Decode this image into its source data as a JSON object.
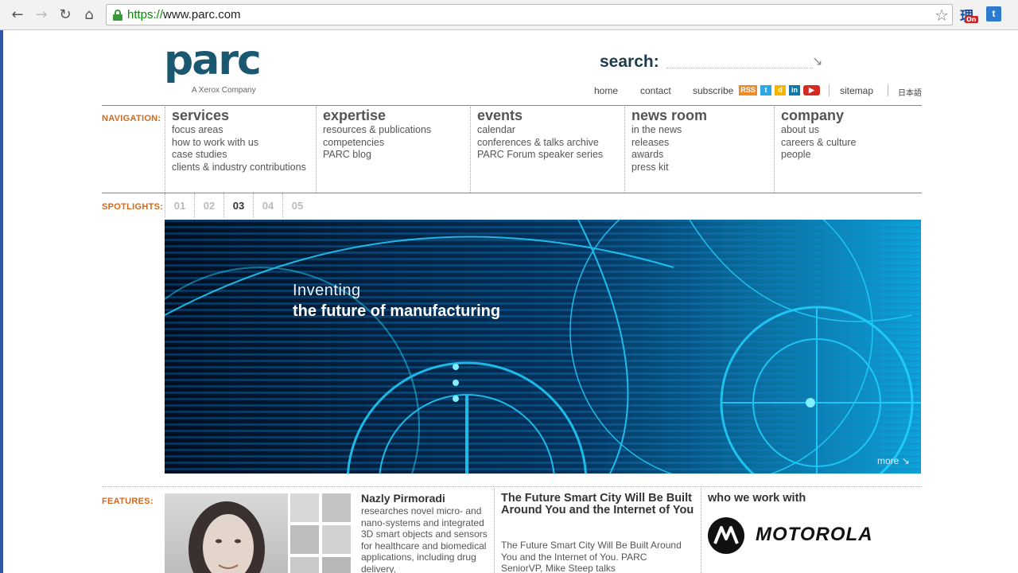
{
  "browser": {
    "url_scheme": "https://",
    "url_host": "www.parc.com",
    "ext1_glyph": "理",
    "ext1_badge": "On",
    "ext2_glyph": "t"
  },
  "header": {
    "logo_text": "parc",
    "logo_tagline": "A Xerox Company",
    "search_label": "search:",
    "search_value": "",
    "top_links": {
      "home": "home",
      "contact": "contact",
      "subscribe": "subscribe",
      "rss": "RSS",
      "sitemap": "sitemap",
      "japanese": "日本語"
    }
  },
  "navigation": {
    "label": "NAVIGATION:",
    "columns": [
      {
        "title": "services",
        "items": [
          "focus areas",
          "how to work with us",
          "case studies",
          "clients & industry contributions"
        ]
      },
      {
        "title": "expertise",
        "items": [
          "resources & publications",
          "competencies",
          "PARC blog"
        ]
      },
      {
        "title": "events",
        "items": [
          "calendar",
          "conferences & talks archive",
          "PARC Forum speaker series"
        ]
      },
      {
        "title": "news room",
        "items": [
          "in the news",
          "releases",
          "awards",
          "press kit"
        ]
      },
      {
        "title": "company",
        "items": [
          "about us",
          "careers & culture",
          "people"
        ]
      }
    ]
  },
  "spotlights": {
    "label": "SPOTLIGHTS:",
    "tabs": [
      "01",
      "02",
      "03",
      "04",
      "05"
    ],
    "active": "03",
    "hero_line1": "Inventing",
    "hero_line2": "the future of manufacturing",
    "more_label": "more"
  },
  "features": {
    "label": "FEATURES:",
    "person_name": "Nazly Pirmoradi",
    "person_body": "researches novel micro- and nano-systems and integrated 3D smart objects and sensors for healthcare and biomedical applications, including drug delivery,",
    "news_title": "The Future Smart City Will Be Built Around You and the Internet of You",
    "news_body": "The Future Smart City Will Be Built Around You and the Internet of You. PARC SeniorVP, Mike Steep talks",
    "partners_title": "who we work with",
    "partner_name": "MOTOROLA"
  },
  "colors": {
    "accent_orange": "#d2691e",
    "logo_teal": "#1a5770",
    "hero_cyan": "#19c8ff"
  }
}
